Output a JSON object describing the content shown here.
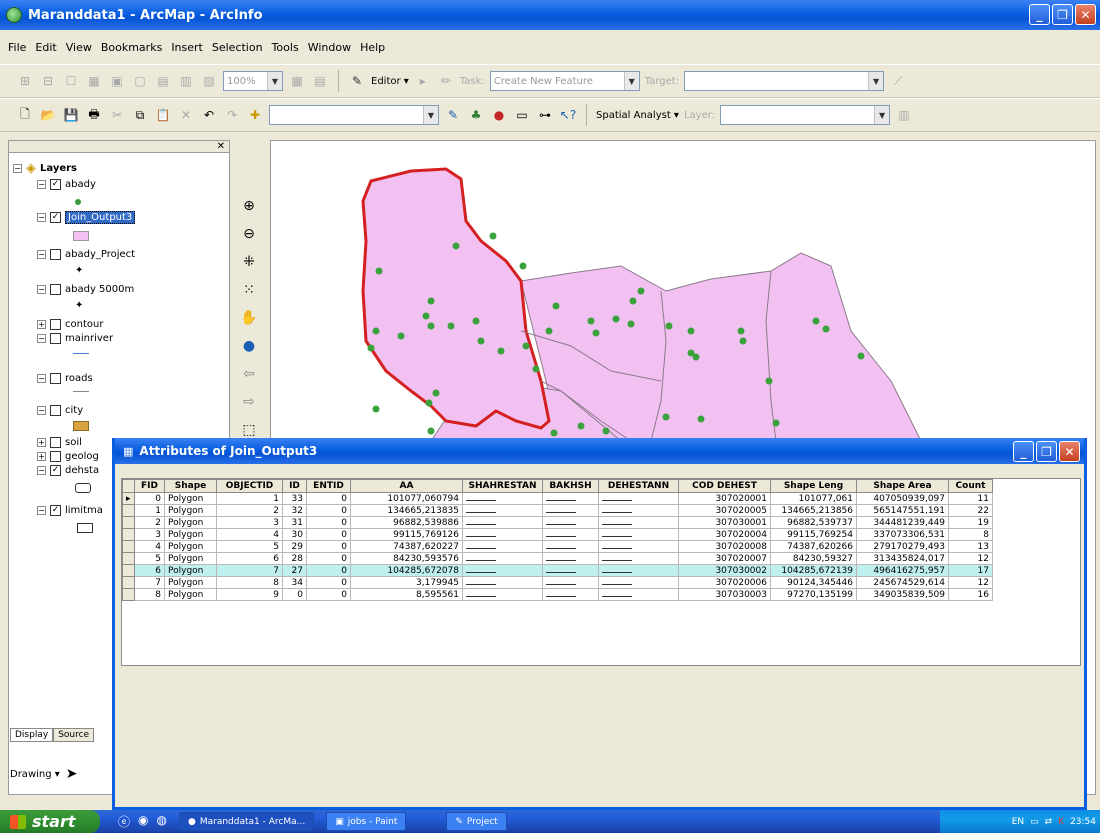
{
  "window": {
    "title": "Maranddata1 - ArcMap - ArcInfo",
    "min": "_",
    "max": "❐",
    "close": "✕"
  },
  "menu": [
    "File",
    "Edit",
    "View",
    "Bookmarks",
    "Insert",
    "Selection",
    "Tools",
    "Window",
    "Help"
  ],
  "toolbar1": {
    "zoom_value": "100%",
    "editor_label": "Editor ▾",
    "task_label": "Task:",
    "task_value": "Create New Feature",
    "target_label": "Target:"
  },
  "toolbar2": {
    "spatial_analyst_label": "Spatial Analyst ▾",
    "layer_label": "Layer:"
  },
  "toc": {
    "root_label": "Layers",
    "tabs": [
      "Display",
      "Source"
    ],
    "drawing_label": "Drawing ▾",
    "layers": [
      {
        "name": "abady",
        "checked": true
      },
      {
        "name": "Join_Output3",
        "checked": true,
        "selected": true
      },
      {
        "name": "abady_Project",
        "checked": false
      },
      {
        "name": "abady 5000m",
        "checked": false
      },
      {
        "name": "contour",
        "checked": false
      },
      {
        "name": "mainriver",
        "checked": false
      },
      {
        "name": "roads",
        "checked": false
      },
      {
        "name": "city",
        "checked": false
      },
      {
        "name": "soil",
        "checked": false
      },
      {
        "name": "geolog",
        "checked": false
      },
      {
        "name": "dehsta",
        "checked": true
      },
      {
        "name": "limitma",
        "checked": true
      }
    ]
  },
  "attributes": {
    "title": "Attributes of Join_Output3",
    "columns": [
      "FID",
      "Shape",
      "OBJECTID",
      "ID",
      "ENTID",
      "AA",
      "SHAHRESTAN",
      "BAKHSH",
      "DEHESTANN",
      "COD DEHEST",
      "Shape Leng",
      "Shape Area",
      "Count"
    ],
    "rows": [
      [
        "0",
        "Polygon",
        "1",
        "33",
        "0",
        "101077,060794",
        "",
        "",
        "",
        "307020001",
        "101077,061",
        "407050939,097",
        "11"
      ],
      [
        "1",
        "Polygon",
        "2",
        "32",
        "0",
        "134665,213835",
        "",
        "",
        "",
        "307020005",
        "134665,213856",
        "565147551,191",
        "22"
      ],
      [
        "2",
        "Polygon",
        "3",
        "31",
        "0",
        "96882,539886",
        "",
        "",
        "",
        "307030001",
        "96882,539737",
        "344481239,449",
        "19"
      ],
      [
        "3",
        "Polygon",
        "4",
        "30",
        "0",
        "99115,769126",
        "",
        "",
        "",
        "307020004",
        "99115,769254",
        "337073306,531",
        "8"
      ],
      [
        "4",
        "Polygon",
        "5",
        "29",
        "0",
        "74387,620227",
        "",
        "",
        "",
        "307020008",
        "74387,620266",
        "279170279,493",
        "13"
      ],
      [
        "5",
        "Polygon",
        "6",
        "28",
        "0",
        "84230,593576",
        "",
        "",
        "",
        "307020007",
        "84230,59327",
        "313435824,017",
        "12"
      ],
      [
        "6",
        "Polygon",
        "7",
        "27",
        "0",
        "104285,672078",
        "",
        "",
        "",
        "307030002",
        "104285,672139",
        "496416275,957",
        "17"
      ],
      [
        "7",
        "Polygon",
        "8",
        "34",
        "0",
        "3,179945",
        "",
        "",
        "",
        "307020006",
        "90124,345446",
        "245674529,614",
        "12"
      ],
      [
        "8",
        "Polygon",
        "9",
        "0",
        "0",
        "8,595561",
        "",
        "",
        "",
        "307030003",
        "97270,135199",
        "349035839,509",
        "16"
      ]
    ],
    "highlighted_row": 6
  },
  "taskbar": {
    "start": "start",
    "tasks": [
      "Maranddata1 - ArcMa...",
      "jobs - Paint",
      "Project"
    ],
    "lang": "EN",
    "clock": "23:54"
  },
  "colors": {
    "polygon_fill": "#f2c1f2",
    "polygon_border": "#8a7a8a",
    "selected_border": "#d42020",
    "point": "#3aa23a",
    "highlight_row": "#bfefef"
  }
}
